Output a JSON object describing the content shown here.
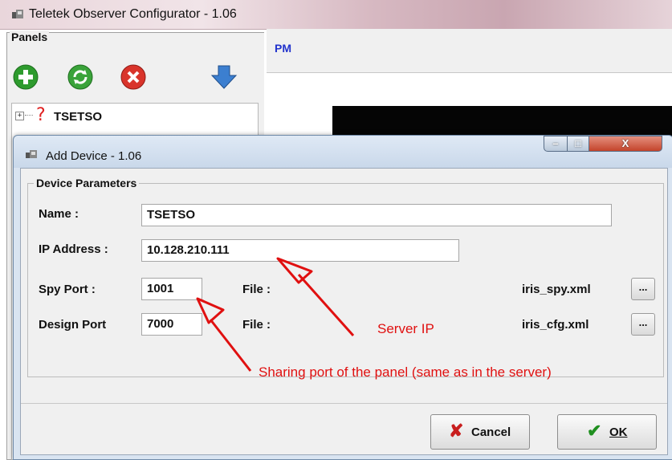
{
  "main_window": {
    "title": "Teletek Observer Configurator  - 1.06"
  },
  "panels": {
    "legend": "Panels",
    "toolbar": [
      {
        "icon": "add-icon",
        "color": "#2e9b2e"
      },
      {
        "icon": "refresh-icon",
        "color": "#3aa33a"
      },
      {
        "icon": "delete-icon",
        "color": "#d9342b"
      },
      {
        "icon": "download-arrow-icon",
        "color": "#3c7fd0"
      }
    ],
    "tree": {
      "expander": "+",
      "status_icon": "?",
      "label": "TSETSO"
    }
  },
  "right_pane": {
    "label": "PM"
  },
  "dialog": {
    "title": "Add Device  - 1.06",
    "group_legend": "Device Parameters",
    "name_label": "Name :",
    "name_value": "TSETSO",
    "ip_label": "IP Address :",
    "ip_value": "10.128.210.111",
    "spy_port_label": "Spy Port :",
    "spy_port_value": "1001",
    "design_port_label": "Design Port",
    "design_port_value": "7000",
    "file_label_1": "File :",
    "file_value_1": "iris_spy.xml",
    "file_label_2": "File :",
    "file_value_2": "iris_cfg.xml",
    "browse_label": "...",
    "cancel_label": "Cancel",
    "ok_label": "OK",
    "min_symbol": "–",
    "max_symbol": "□",
    "close_symbol": "X"
  },
  "annotations": {
    "server_ip": "Server IP",
    "sharing_port": "Sharing port of the panel (same as in the server)",
    "color": "#e01010"
  }
}
